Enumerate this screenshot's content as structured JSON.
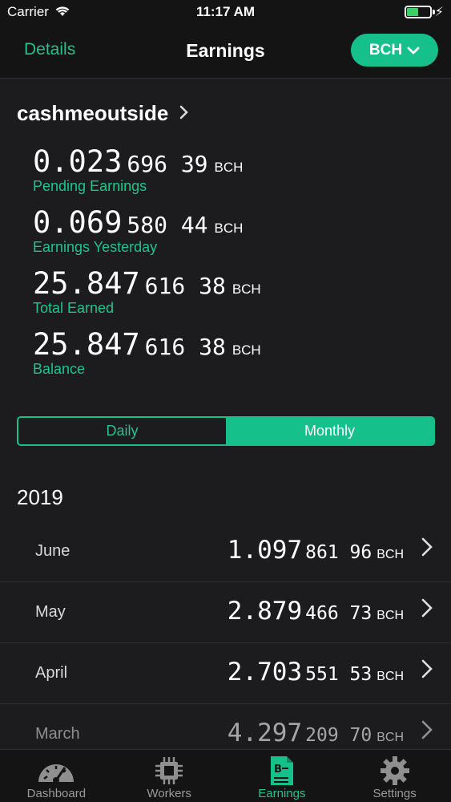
{
  "status": {
    "carrier": "Carrier",
    "time": "11:17 AM"
  },
  "nav": {
    "left": "Details",
    "title": "Earnings",
    "currency": "BCH"
  },
  "account": {
    "name": "cashmeoutside"
  },
  "stats": [
    {
      "big": "0.023",
      "small": "696 39",
      "unit": "BCH",
      "label": "Pending Earnings"
    },
    {
      "big": "0.069",
      "small": "580 44",
      "unit": "BCH",
      "label": "Earnings Yesterday"
    },
    {
      "big": "25.847",
      "small": "616 38",
      "unit": "BCH",
      "label": "Total Earned"
    },
    {
      "big": "25.847",
      "small": "616 38",
      "unit": "BCH",
      "label": "Balance"
    }
  ],
  "segment": {
    "daily": "Daily",
    "monthly": "Monthly",
    "selected": "Monthly"
  },
  "year": "2019",
  "months": [
    {
      "name": "June",
      "big": "1.097",
      "small": "861 96",
      "unit": "BCH"
    },
    {
      "name": "May",
      "big": "2.879",
      "small": "466 73",
      "unit": "BCH"
    },
    {
      "name": "April",
      "big": "2.703",
      "small": "551 53",
      "unit": "BCH"
    },
    {
      "name": "March",
      "big": "4.297",
      "small": "209 70",
      "unit": "BCH"
    }
  ],
  "tabs": [
    {
      "label": "Dashboard",
      "icon": "gauge-icon"
    },
    {
      "label": "Workers",
      "icon": "chip-icon"
    },
    {
      "label": "Earnings",
      "icon": "bch-document-icon",
      "active": true
    },
    {
      "label": "Settings",
      "icon": "gear-icon"
    }
  ],
  "colors": {
    "accent": "#16c08b",
    "background": "#1c1c1e",
    "bar": "#141414"
  }
}
